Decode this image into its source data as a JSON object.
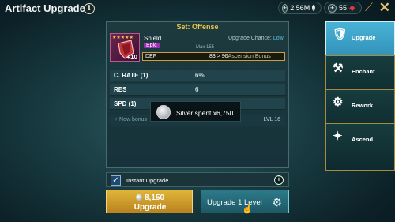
{
  "header": {
    "title": "Artifact Upgrade",
    "silver_amount": "2.56M",
    "gem_amount": "55"
  },
  "panel": {
    "set_title": "Set: Offense",
    "artifact": {
      "name": "Shield",
      "rarity": "Epic",
      "level": "+10",
      "upgrade_chance_label": "Upgrade Chance:",
      "upgrade_chance_value": "Low",
      "max_label": "Max 155",
      "main_stat": "DEF",
      "main_value": "83 > 90",
      "ascension_label": "+ Ascension Bonus"
    },
    "stats": [
      {
        "name": "C. RATE (1)",
        "value": "6%"
      },
      {
        "name": "RES",
        "value": "6"
      },
      {
        "name": "SPD (1)",
        "value": ""
      }
    ],
    "new_bonus_label": "+ New bonus",
    "new_bonus_level": "LVL 16"
  },
  "toast": {
    "text": "Silver spent x6,750"
  },
  "instant": {
    "label": "Instant Upgrade",
    "checked": true
  },
  "buttons": {
    "upgrade_cost": "8,150",
    "upgrade_label": "Upgrade",
    "upgrade_level_label": "Upgrade 1 Level"
  },
  "side_tabs": [
    {
      "label": "Upgrade",
      "icon": "armor-icon",
      "active": true
    },
    {
      "label": "Enchant",
      "icon": "anvil-icon",
      "active": false
    },
    {
      "label": "Rework",
      "icon": "hammer-wrench-icon",
      "active": false
    },
    {
      "label": "Ascend",
      "icon": "ascend-icon",
      "active": false
    }
  ],
  "colors": {
    "accent_gold": "#e0b53a",
    "accent_teal": "#2d7a8a",
    "epic_purple": "#9c2fb4",
    "chance_blue": "#5fc4ee"
  }
}
